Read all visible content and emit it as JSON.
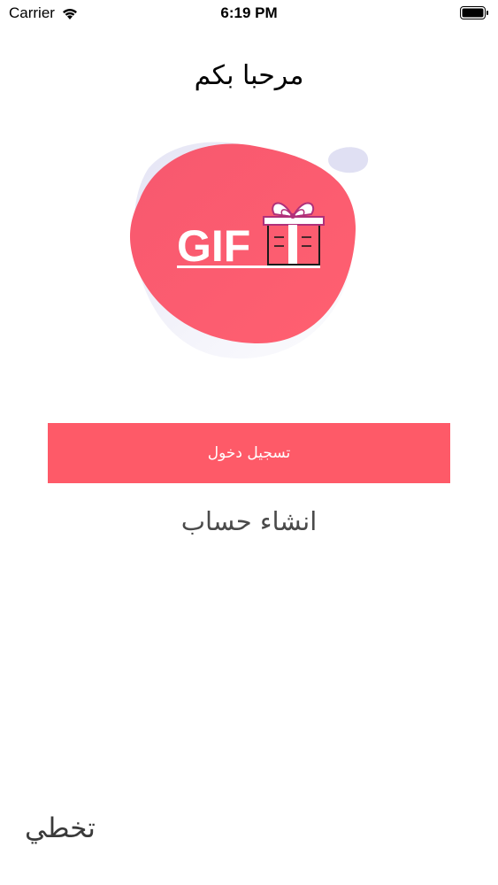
{
  "status_bar": {
    "carrier": "Carrier",
    "time": "6:19 PM",
    "wifi_icon": "wifi-icon",
    "battery_icon": "battery-icon"
  },
  "welcome": {
    "title": "مرحبا بكم"
  },
  "logo": {
    "text": "GIF",
    "blob_color": "#fe5a6e",
    "accent_color": "#c0c0e8",
    "ribbon_color": "#b0307a"
  },
  "actions": {
    "login_label": "تسجيل دخول",
    "create_account_label": "انشاء حساب",
    "skip_label": "تخطي",
    "button_color": "#fe5a68"
  }
}
